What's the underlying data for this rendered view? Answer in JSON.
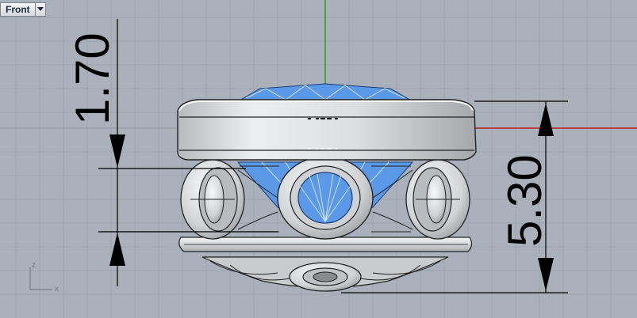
{
  "viewport": {
    "name": "Front",
    "background": "#aab1ba",
    "grid_color": "#9aa1aa",
    "x_axis_color": "#b81c1c",
    "z_axis_color": "#2c9a2c"
  },
  "dimensions": {
    "left": "1.70",
    "right": "5.30"
  },
  "axis_widget": {
    "vertical": "z",
    "horizontal": "x"
  },
  "model": {
    "metal_color": "#dadcde",
    "gem_color": "#5a98e8"
  },
  "icons": [
    "dropdown-arrow-icon",
    "axis-widget-icon"
  ]
}
